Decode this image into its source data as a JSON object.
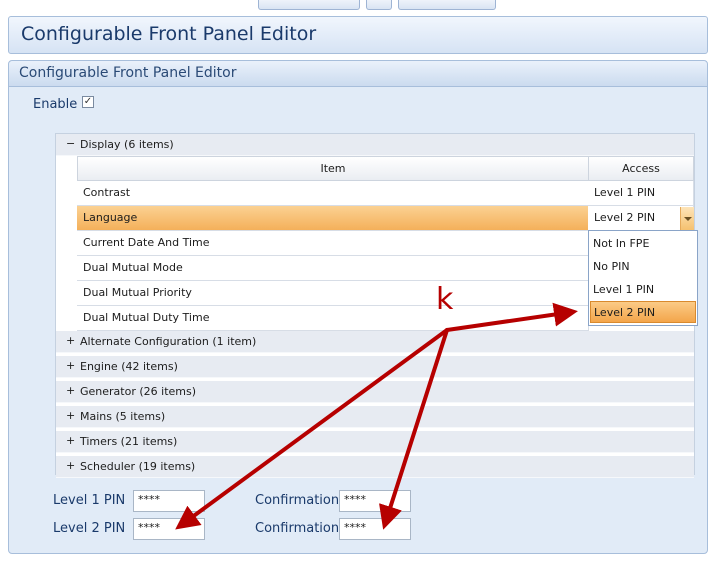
{
  "window": {
    "title": "Configurable Front Panel Editor"
  },
  "panel": {
    "title": "Configurable Front Panel Editor",
    "enable_label": "Enable",
    "enable_checked": "✓"
  },
  "grid": {
    "display_group": {
      "toggle": "−",
      "label": "Display (6 items)"
    },
    "columns": {
      "item": "Item",
      "access": "Access"
    },
    "rows": [
      {
        "item": "Contrast",
        "access": "Level 1 PIN"
      },
      {
        "item": "Language",
        "access": "Level 2 PIN"
      },
      {
        "item": "Current Date And Time",
        "access": ""
      },
      {
        "item": "Dual Mutual Mode",
        "access": ""
      },
      {
        "item": "Dual Mutual Priority",
        "access": ""
      },
      {
        "item": "Dual Mutual Duty Time",
        "access": ""
      }
    ],
    "dropdown_options": [
      "Not In FPE",
      "No PIN",
      "Level 1 PIN",
      "Level 2 PIN"
    ],
    "dropdown_selected": "Level 2 PIN",
    "groups": [
      {
        "toggle": "+",
        "label": "Alternate Configuration (1 item)"
      },
      {
        "toggle": "+",
        "label": "Engine (42 items)"
      },
      {
        "toggle": "+",
        "label": "Generator (26 items)"
      },
      {
        "toggle": "+",
        "label": "Mains (5 items)"
      },
      {
        "toggle": "+",
        "label": "Timers (21 items)"
      },
      {
        "toggle": "+",
        "label": "Scheduler (19 items)"
      }
    ]
  },
  "pins": {
    "level1_label": "Level 1 PIN",
    "level1_value": "****",
    "level1_confirm_label": "Confirmation",
    "level1_confirm_value": "****",
    "level2_label": "Level 2 PIN",
    "level2_value": "****",
    "level2_confirm_label": "Confirmation",
    "level2_confirm_value": "****"
  },
  "annotation": {
    "label": "k",
    "color": "#b60000"
  }
}
